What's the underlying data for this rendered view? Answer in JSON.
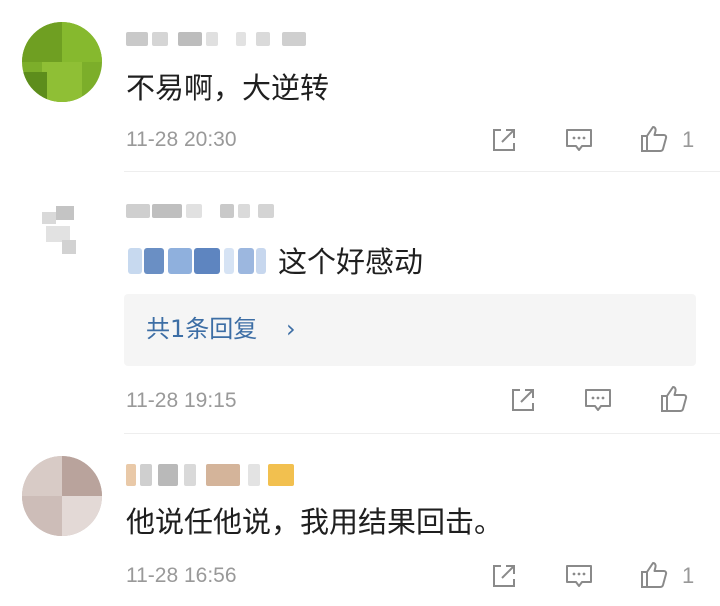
{
  "comments": [
    {
      "text": "不易啊，大逆转",
      "time": "11-28 20:30",
      "likes": "1"
    },
    {
      "text": "这个好感动",
      "time": "11-28 19:15",
      "likes": "",
      "reply_summary": "共1条回复",
      "reply_chevron": "›"
    },
    {
      "text": "他说任他说，我用结果回击。",
      "time": "11-28 16:56",
      "likes": "1"
    }
  ],
  "icons": {
    "share": "share-icon",
    "comment": "comment-icon",
    "like": "thumbs-up-icon"
  },
  "colors": {
    "link": "#3d6ea5",
    "meta": "#999999",
    "reply_bg": "#f5f5f5"
  }
}
